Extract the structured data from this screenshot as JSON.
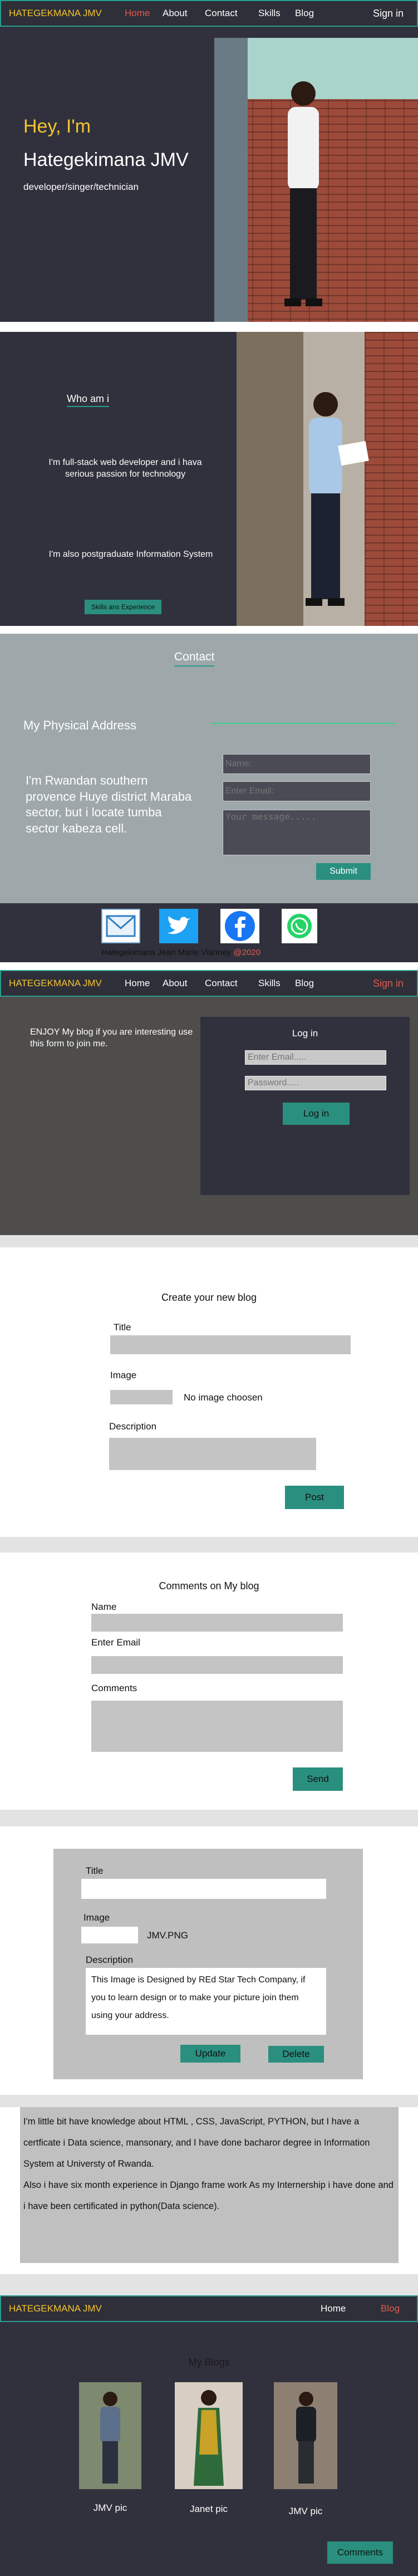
{
  "nav": {
    "brand": "HATEGEKMANA JMV",
    "items": [
      "Home",
      "About",
      "Contact",
      "Skills",
      "Blog"
    ],
    "signin": "Sign in"
  },
  "hero": {
    "greeting": "Hey, I'm",
    "name": "Hategekimana JMV",
    "role": "developer/singer/technician"
  },
  "about": {
    "heading": "Who am i",
    "text1": "I'm full-stack web developer and i hava serious passion for technology",
    "text2": "I'm also postgraduate Information System",
    "button": "Skills ans Experience"
  },
  "contact": {
    "heading": "Contact",
    "address_title": "My Physical Address",
    "address_text": "I'm Rwandan southern provence Huye district Maraba sector, but i locate tumba sector kabeza cell.",
    "name_placeholder": "Name:",
    "email_placeholder": "Enter Email:",
    "message_placeholder": "Your message.....",
    "submit": "Submit"
  },
  "footer": {
    "copyright": "Hategekimana Jean Marie Vianney",
    "year": "@2020",
    "social": [
      "mail-icon",
      "twitter-icon",
      "facebook-icon",
      "whatsapp-icon"
    ]
  },
  "login": {
    "nav_items": [
      "Home",
      "About",
      "Contact",
      "Skills",
      "Blog"
    ],
    "signin": "Sign in",
    "intro": "ENJOY My blog if you are interesting use this form to join me.",
    "title": "Log in",
    "email_placeholder": "Enter Email.....",
    "password_placeholder": "Password.....",
    "button": "Log in"
  },
  "create_blog": {
    "title": "Create your new blog",
    "label_title": "Title",
    "label_image": "Image",
    "no_image": "No image choosen",
    "label_description": "Description",
    "button": "Post"
  },
  "comments": {
    "title": "Comments on My blog",
    "label_name": "Name",
    "label_email": "Enter Email",
    "label_comments": "Comments",
    "button": "Send"
  },
  "edit_blog": {
    "label_title": "Title",
    "label_image": "Image",
    "image_name": "JMV.PNG",
    "label_description": "Description",
    "description": "This Image is Designed by REd Star Tech Company, if you to learn design or to make your picture join them using your address.",
    "update": "Update",
    "delete": "Delete"
  },
  "bio": {
    "paragraph1": "I'm little bit  have knowledge about HTML , CSS, JavaScript, PYTHON,  but I have a certficate i Data science, mansonary, and I have done bacharor degree in Information System at Universty of Rwanda.",
    "paragraph2": "Also i have six month experience in Django frame work As my Internership i have done and i have been certificated in python(Data science)."
  },
  "blogs_page": {
    "brand": "HATEGEKMANA JMV",
    "home": "Home",
    "blog": "Blog",
    "heading": "My Blogs",
    "cards": [
      {
        "caption": "JMV pic"
      },
      {
        "caption": "Janet pic"
      },
      {
        "caption": "JMV pic"
      }
    ],
    "comments_button": "Comments"
  },
  "colors": {
    "accent": "#2a9d8f",
    "brand": "#f4c430",
    "active": "#e05a4f",
    "dark": "#31313d"
  }
}
